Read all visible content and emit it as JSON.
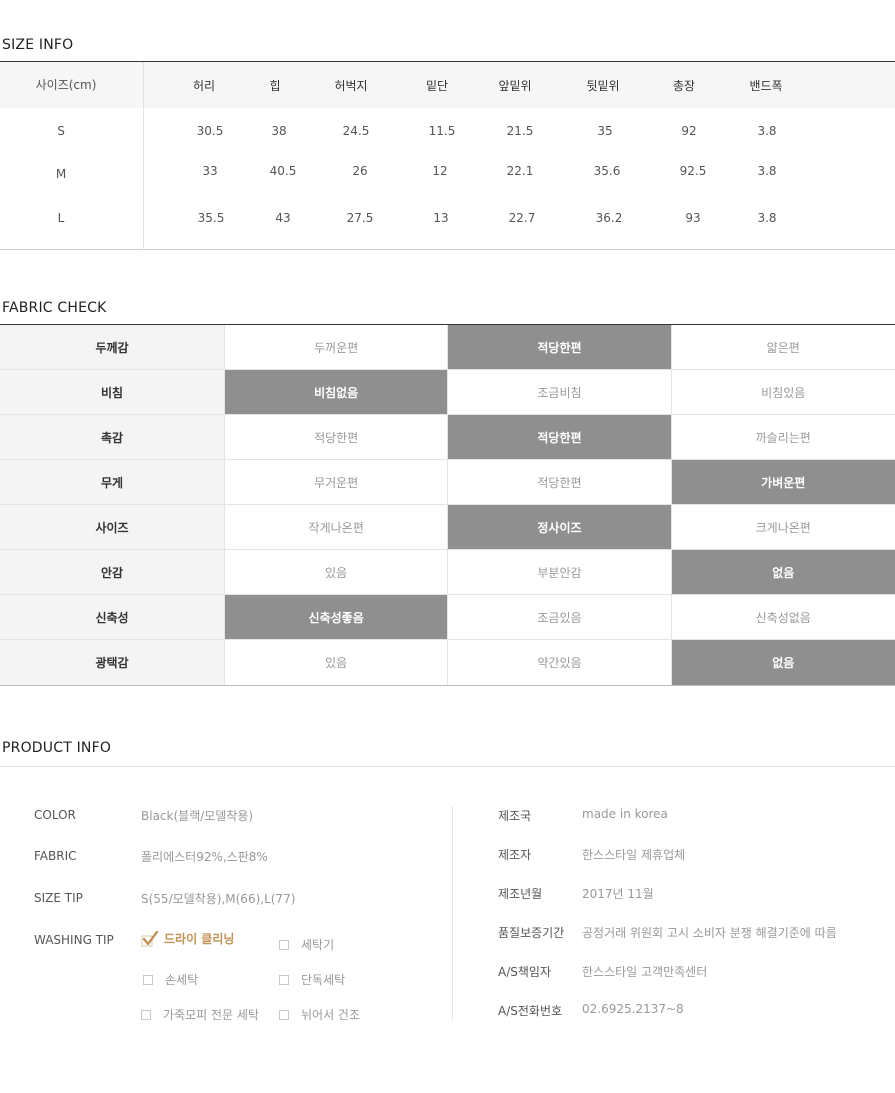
{
  "size_info": {
    "title": "SIZE INFO",
    "header_label": "사이즈(cm)",
    "columns": [
      "허리",
      "힙",
      "허벅지",
      "밑단",
      "앞밑위",
      "뒷밑위",
      "총장",
      "밴드폭"
    ],
    "rows": [
      {
        "size": "S",
        "values": [
          "30.5",
          "38",
          "24.5",
          "11.5",
          "21.5",
          "35",
          "92",
          "3.8"
        ]
      },
      {
        "size": "M",
        "values": [
          "33",
          "40.5",
          "26",
          "12",
          "22.1",
          "35.6",
          "92.5",
          "3.8"
        ]
      },
      {
        "size": "L",
        "values": [
          "35.5",
          "43",
          "27.5",
          "13",
          "22.7",
          "36.2",
          "93",
          "3.8"
        ]
      }
    ]
  },
  "fabric_check": {
    "title": "FABRIC CHECK",
    "rows": [
      {
        "label": "두께감",
        "options": [
          "두꺼운편",
          "적당한편",
          "얇은편"
        ],
        "selected": 1
      },
      {
        "label": "비침",
        "options": [
          "비침없음",
          "조금비침",
          "비침있음"
        ],
        "selected": 0
      },
      {
        "label": "촉감",
        "options": [
          "적당한편",
          "적당한편",
          "까슬리는편"
        ],
        "selected": 1
      },
      {
        "label": "무게",
        "options": [
          "무거운편",
          "적당한편",
          "가벼운편"
        ],
        "selected": 2
      },
      {
        "label": "사이즈",
        "options": [
          "작게나온편",
          "정사이즈",
          "크게나온편"
        ],
        "selected": 1
      },
      {
        "label": "안감",
        "options": [
          "있음",
          "부분안감",
          "없음"
        ],
        "selected": 2
      },
      {
        "label": "신축성",
        "options": [
          "신축성좋음",
          "조금있음",
          "신축성없음"
        ],
        "selected": 0
      },
      {
        "label": "광택감",
        "options": [
          "있음",
          "약간있음",
          "없음"
        ],
        "selected": 2
      }
    ],
    "selected_color": "#8f8f8f"
  },
  "product_info": {
    "title": "PRODUCT INFO",
    "color_label": "COLOR",
    "color_value": "Black(블랙/모델착용)",
    "fabric_label": "FABRIC",
    "fabric_value": "폴리에스터92%,스판8%",
    "size_tip_label": "SIZE TIP",
    "size_tip_value": "S(55/모델착용),M(66),L(77)",
    "washing_label": "WASHING TIP",
    "washing_options": [
      {
        "label": "드라이 클리닝",
        "checked": true
      },
      {
        "label": "세탁기",
        "checked": false
      },
      {
        "label": "손세탁",
        "checked": false
      },
      {
        "label": "단독세탁",
        "checked": false
      },
      {
        "label": "가죽모피 전문 세탁",
        "checked": false
      },
      {
        "label": "뉘어서 건조",
        "checked": false
      }
    ],
    "check_color": "#c29356",
    "details": [
      {
        "label": "제조국",
        "value": "made in korea"
      },
      {
        "label": "제조자",
        "value": "한스스타일 제휴업체"
      },
      {
        "label": "제조년월",
        "value": "2017년 11월"
      },
      {
        "label": "품질보증기간",
        "value": "공정거래 위원회 고시 소비자 분쟁 해결기준에 따름"
      },
      {
        "label": "A/S책임자",
        "value": "한스스타일 고객만족센터"
      },
      {
        "label": "A/S전화번호",
        "value": "02.6925.2137~8"
      }
    ]
  }
}
